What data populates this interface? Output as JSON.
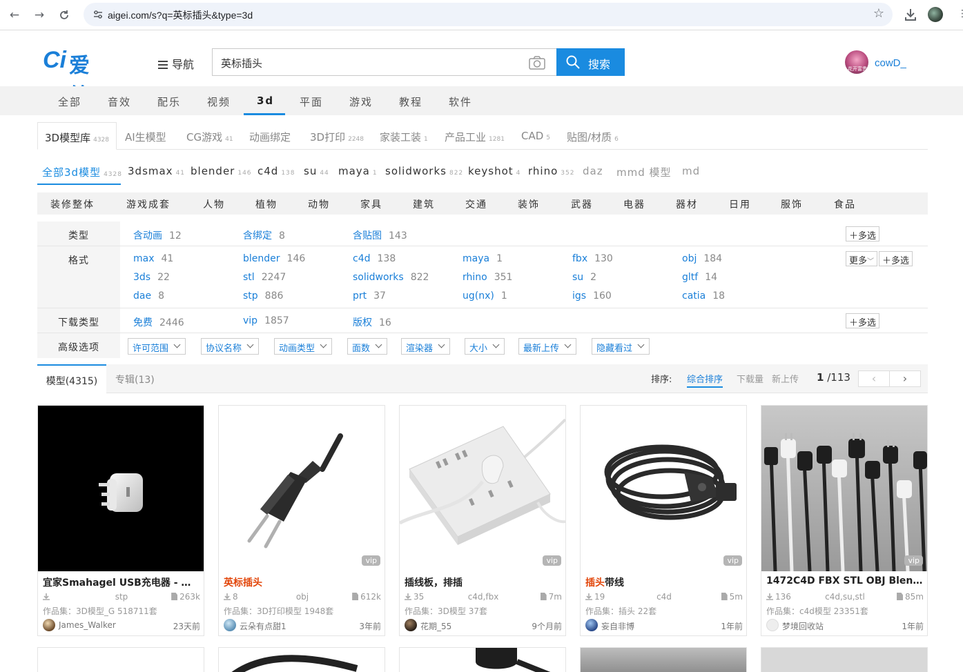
{
  "browser": {
    "url": "aigei.com/s?q=英标插头&type=3d"
  },
  "header": {
    "logo_mark": "Ci",
    "logo_text": "爱给",
    "nav_label": "导航",
    "search_value": "英标插头",
    "search_button": "搜索",
    "user_name": "cowD_",
    "avatar_caption": "花开富贵"
  },
  "categories": [
    "全部",
    "音效",
    "配乐",
    "视频",
    "3d",
    "平面",
    "游戏",
    "教程",
    "软件"
  ],
  "library_tabs": [
    {
      "label": "3D模型库",
      "count": "4328"
    },
    {
      "label": "AI生模型",
      "count": ""
    },
    {
      "label": "CG游戏",
      "count": "41"
    },
    {
      "label": "动画绑定",
      "count": ""
    },
    {
      "label": "3D打印",
      "count": "2248"
    },
    {
      "label": "家装工装",
      "count": "1"
    },
    {
      "label": "产品工业",
      "count": "1281"
    },
    {
      "label": "CAD",
      "count": "5"
    },
    {
      "label": "贴图/材质",
      "count": "6"
    }
  ],
  "sub_tabs": [
    {
      "label": "全部3d模型",
      "count": "4328"
    },
    {
      "label": "3dsmax",
      "count": "41"
    },
    {
      "label": "blender",
      "count": "146"
    },
    {
      "label": "c4d",
      "count": "138"
    },
    {
      "label": "su",
      "count": "44"
    },
    {
      "label": "maya",
      "count": "1"
    },
    {
      "label": "solidworks",
      "count": "822"
    },
    {
      "label": "keyshot",
      "count": "4"
    },
    {
      "label": "rhino",
      "count": "352"
    },
    {
      "label": "daz",
      "count": ""
    },
    {
      "label": "mmd 模型",
      "count": ""
    },
    {
      "label": "md",
      "count": ""
    }
  ],
  "genres": [
    "装修整体",
    "游戏成套",
    "人物",
    "植物",
    "动物",
    "家具",
    "建筑",
    "交通",
    "装饰",
    "武器",
    "电器",
    "器材",
    "日用",
    "服饰",
    "食品"
  ],
  "filters": {
    "type_label": "类型",
    "type_options": [
      {
        "name": "含动画",
        "count": "12"
      },
      {
        "name": "含绑定",
        "count": "8"
      },
      {
        "name": "含贴图",
        "count": "143"
      }
    ],
    "format_label": "格式",
    "format_options": [
      {
        "name": "max",
        "count": "41"
      },
      {
        "name": "blender",
        "count": "146"
      },
      {
        "name": "c4d",
        "count": "138"
      },
      {
        "name": "maya",
        "count": "1"
      },
      {
        "name": "fbx",
        "count": "130"
      },
      {
        "name": "obj",
        "count": "184"
      },
      {
        "name": "3ds",
        "count": "22"
      },
      {
        "name": "stl",
        "count": "2247"
      },
      {
        "name": "solidworks",
        "count": "822"
      },
      {
        "name": "rhino",
        "count": "351"
      },
      {
        "name": "su",
        "count": "2"
      },
      {
        "name": "gltf",
        "count": "14"
      },
      {
        "name": "dae",
        "count": "8"
      },
      {
        "name": "stp",
        "count": "886"
      },
      {
        "name": "prt",
        "count": "37"
      },
      {
        "name": "ug(nx)",
        "count": "1"
      },
      {
        "name": "igs",
        "count": "160"
      },
      {
        "name": "catia",
        "count": "18"
      }
    ],
    "download_label": "下载类型",
    "download_options": [
      {
        "name": "免费",
        "count": "2446"
      },
      {
        "name": "vip",
        "count": "1857"
      },
      {
        "name": "版权",
        "count": "16"
      }
    ],
    "advanced_label": "高级选项",
    "advanced_dropdowns": [
      "许可范围",
      "协议名称",
      "动画类型",
      "面数",
      "渲染器",
      "大小",
      "最新上传",
      "隐藏看过"
    ],
    "multi_select": "多选",
    "more": "更多"
  },
  "results": {
    "tab_models": "模型(4315)",
    "tab_albums": "专辑(13)",
    "sort_label": "排序:",
    "sort_options": [
      "综合排序",
      "下载量",
      "新上传"
    ],
    "page_current": "1",
    "page_total": "/113"
  },
  "cards": [
    {
      "title_pre": "宜家Smahagel USB充电器 - ",
      "title_hl": "英...",
      "title_post": "",
      "downloads": "",
      "format": "stp",
      "size": "263k",
      "collection": "作品集：3D模型_G 518711套",
      "author": "James_Walker",
      "time": "23天前",
      "vip": ""
    },
    {
      "title_pre": "",
      "title_hl": "英标插头",
      "title_post": "",
      "downloads": "8",
      "format": "obj",
      "size": "612k",
      "collection": "作品集：3D打印模型 1948套",
      "author": "云朵有点甜1",
      "time": "3年前",
      "vip": "vip"
    },
    {
      "title_pre": "插线板，排插",
      "title_hl": "",
      "title_post": "",
      "downloads": "35",
      "format": "c4d,fbx",
      "size": "7m",
      "collection": "作品集：3D模型 37套",
      "author": "花期_55",
      "time": "9个月前",
      "vip": "vip"
    },
    {
      "title_pre": "",
      "title_hl": "插头",
      "title_post": "带线",
      "downloads": "19",
      "format": "c4d",
      "size": "5m",
      "collection": "作品集：插头 22套",
      "author": "妄自非博",
      "time": "1年前",
      "vip": "vip"
    },
    {
      "title_pre": "1472C4D FBX STL OBJ Blende...",
      "title_hl": "",
      "title_post": "",
      "downloads": "136",
      "format": "c4d,su,stl",
      "size": "85m",
      "collection": "作品集：c4d模型 23351套",
      "author": "梦境回收站",
      "time": "1年前",
      "vip": "vip"
    }
  ],
  "colors": {
    "accent": "#1a8be0",
    "link": "#1a7fd8",
    "highlight": "#e2460a"
  }
}
